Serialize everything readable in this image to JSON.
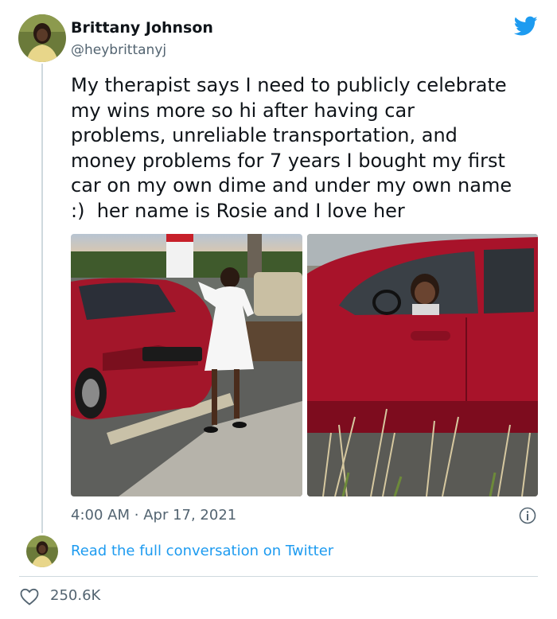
{
  "tweet": {
    "author": {
      "name": "Brittany Johnson",
      "handle": "@heybrittanyj"
    },
    "text": "My therapist says I need to publicly celebrate\nmy wins more so hi after having car\nproblems, unreliable transportation, and\nmoney problems for 7 years I bought my first\ncar on my own dime and under my own name\n:)  her name is Rosie and I love her",
    "photos": [
      {
        "name": "woman-standing-by-red-car"
      },
      {
        "name": "woman-in-red-car-driver-seat"
      }
    ],
    "timestamp": {
      "time": "4:00 AM",
      "separator": "·",
      "date": "Apr 17, 2021"
    },
    "read_more": "Read the full conversation on Twitter",
    "likes": "250.6K"
  },
  "icons": {
    "brand": "twitter-bird-icon",
    "info": "info-icon",
    "like": "heart-icon"
  },
  "colors": {
    "brand": "#1d9bf0",
    "link": "#1d9bf0",
    "text": "#0f1419",
    "muted": "#536471",
    "divider": "#cfd9de"
  }
}
